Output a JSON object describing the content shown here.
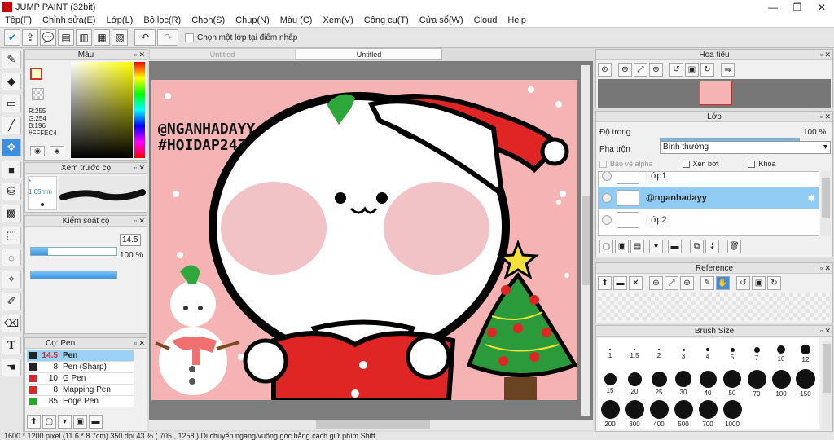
{
  "window": {
    "title": "JUMP PAINT (32bit)",
    "minimize": "—",
    "restore": "❐",
    "close": "✕"
  },
  "menu": [
    "Tệp(F)",
    "Chỉnh sửa(E)",
    "Lớp(L)",
    "Bộ lọc(R)",
    "Chọn(S)",
    "Chụp(N)",
    "Màu (C)",
    "Xem(V)",
    "Công cụ(T)",
    "Cửa sổ(W)",
    "Cloud",
    "Help"
  ],
  "toolbar": {
    "checkbox_label": "Chọn một lớp tại điểm nhấp"
  },
  "tabs": [
    "Untitled",
    "Untitled"
  ],
  "color_panel": {
    "title": "Màu",
    "r": "R:255",
    "g": "G:254",
    "b": "B:196",
    "hex": "#FFFEC4",
    "fg_color": "#fffec4",
    "accent": "#d63030"
  },
  "brush_preview": {
    "title": "Xem trước cọ",
    "size": "* 1.05mm"
  },
  "brush_control": {
    "title": "Kiểm soát cọ",
    "size_value": "14.5",
    "opacity_value": "100 %",
    "size_fraction": 0.2,
    "opacity_fraction": 1.0
  },
  "brush_list": {
    "title": "Cọ: Pen",
    "items": [
      {
        "size": "14.5",
        "name": "Pen",
        "color": "#222222",
        "selected": true
      },
      {
        "size": "8",
        "name": "Pen (Sharp)",
        "color": "#222222",
        "selected": false
      },
      {
        "size": "10",
        "name": "G Pen",
        "color": "#d42a2a",
        "selected": false
      },
      {
        "size": "8",
        "name": "Mapping Pen",
        "color": "#d42a2a",
        "selected": false
      },
      {
        "size": "85",
        "name": "Edge Pen",
        "color": "#22aa22",
        "selected": false
      }
    ]
  },
  "canvas": {
    "watermark_line1": "@NGANHADAYY",
    "watermark_line2": "#HOIDAP247"
  },
  "navigator": {
    "title": "Hoa tiêu"
  },
  "layers": {
    "title": "Lớp",
    "opacity_label": "Độ trong",
    "opacity_value": "100 %",
    "blend_label": "Pha trộn",
    "blend_value": "Bình thường",
    "protect_alpha": "Bảo vệ alpha",
    "clip": "Xén bớt",
    "lock": "Khóa",
    "items": [
      {
        "name": "Lớp1",
        "selected": false
      },
      {
        "name": "@nganhadayy",
        "selected": true
      },
      {
        "name": "Lớp2",
        "selected": false
      }
    ]
  },
  "reference": {
    "title": "Reference"
  },
  "brush_size": {
    "title": "Brush Size",
    "sizes": [
      "1",
      "1.5",
      "2",
      "3",
      "4",
      "5",
      "7",
      "10",
      "12",
      "15",
      "20",
      "25",
      "30",
      "40",
      "50",
      "70",
      "100",
      "150",
      "200",
      "300",
      "400",
      "500",
      "700",
      "1000"
    ]
  },
  "status": {
    "text": "1600 * 1200 pixel   (11.6 * 8.7cm)   350 dpi   43 %   ( 705 , 1258 )   Di chuyển ngang/vuông góc bằng cách giữ phím Shift"
  }
}
